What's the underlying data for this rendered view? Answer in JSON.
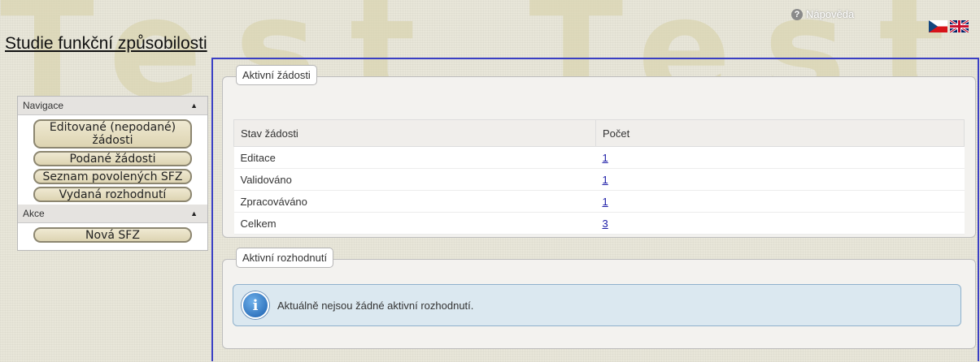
{
  "header": {
    "title": "Studie funkční způsobilosti",
    "help_label": "Nápověda",
    "watermark": "Test Test"
  },
  "sidebar": {
    "sections": [
      {
        "label": "Navigace",
        "items": [
          {
            "label": "Editované (nepodané) žádosti"
          },
          {
            "label": "Podané žádosti"
          },
          {
            "label": "Seznam povolených SFZ"
          },
          {
            "label": "Vydaná rozhodnutí"
          }
        ]
      },
      {
        "label": "Akce",
        "items": [
          {
            "label": "Nová SFZ"
          }
        ]
      }
    ]
  },
  "active_requests": {
    "legend": "Aktivní žádosti",
    "columns": [
      "Stav žádosti",
      "Počet"
    ],
    "rows": [
      {
        "state": "Editace",
        "count": "1"
      },
      {
        "state": "Validováno",
        "count": "1"
      },
      {
        "state": "Zpracováváno",
        "count": "1"
      },
      {
        "state": "Celkem",
        "count": "3"
      }
    ]
  },
  "active_decisions": {
    "legend": "Aktivní rozhodnutí",
    "message": "Aktuálně nejsou žádné aktivní rozhodnutí."
  },
  "icons": {
    "help": "help-circle-icon",
    "lang_cz": "czech-flag-icon",
    "lang_en": "uk-flag-icon",
    "collapse": "caret-up-icon",
    "info": "info-circle-icon"
  },
  "colors": {
    "accent_border": "#3a3fc4",
    "link": "#1a1aa6",
    "info_bg": "#dbe8f0"
  }
}
